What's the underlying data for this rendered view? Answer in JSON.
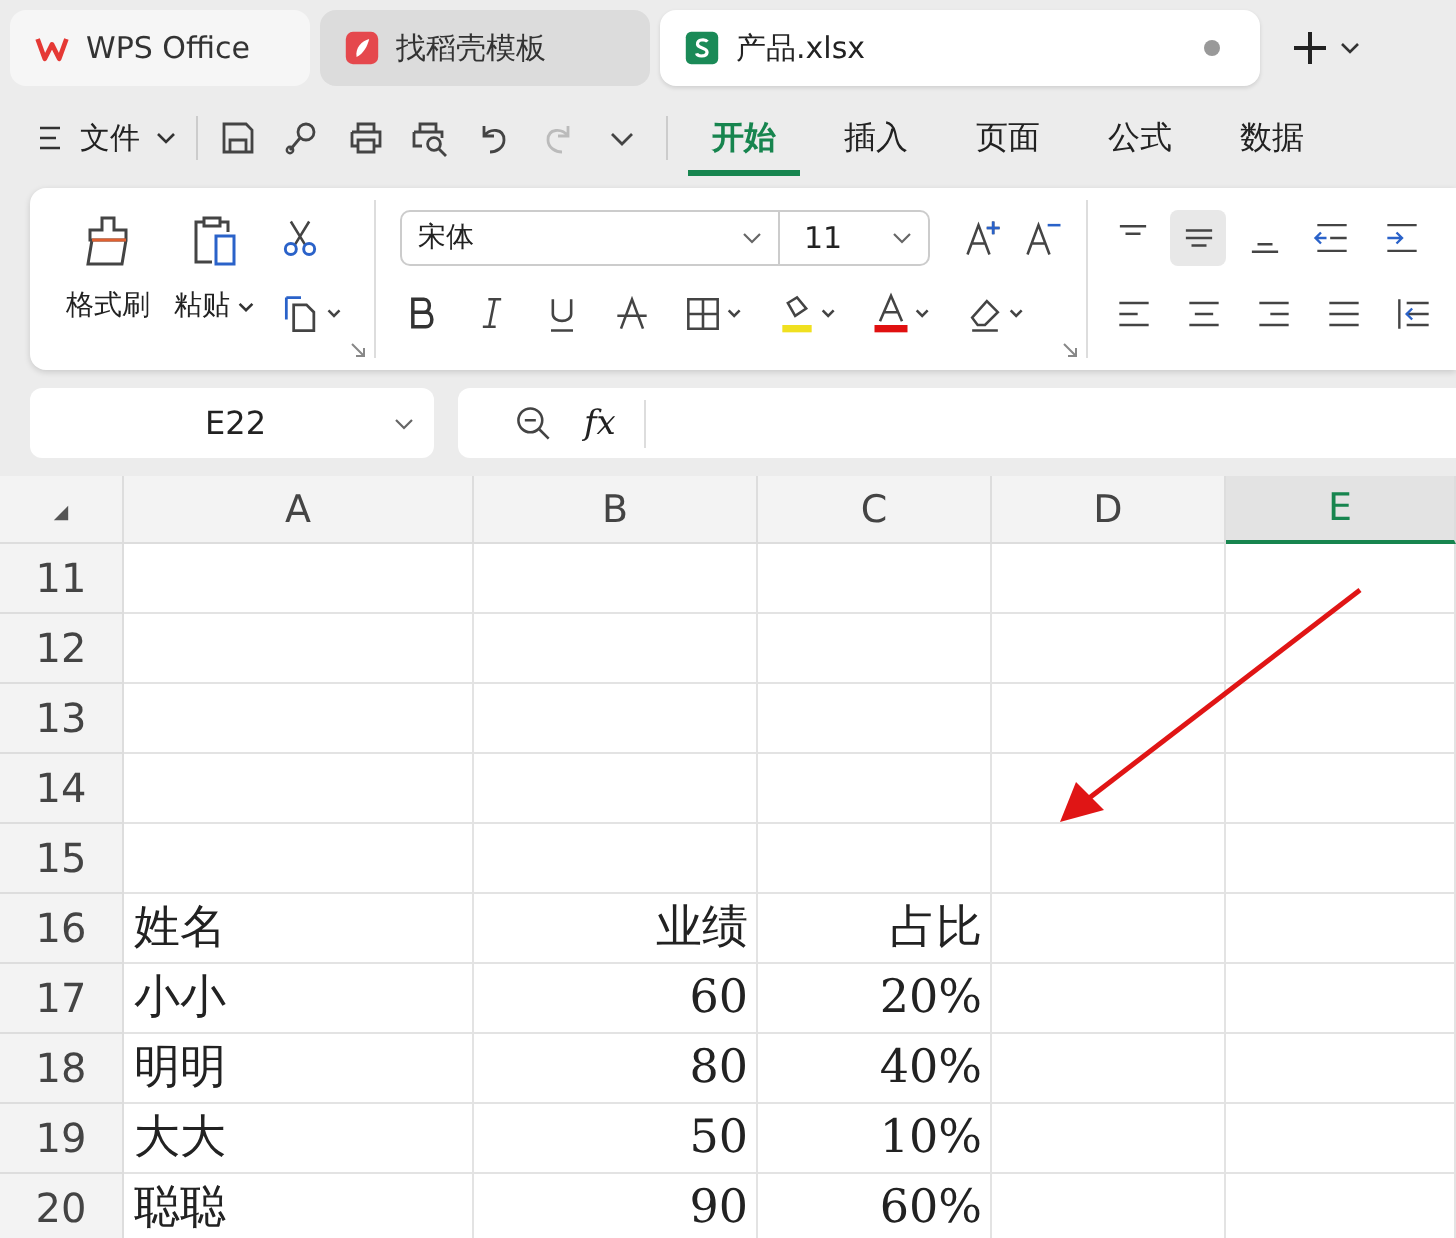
{
  "tabs": [
    {
      "label": "WPS Office",
      "kind": "wps",
      "selected": false
    },
    {
      "label": "找稻壳模板",
      "kind": "template",
      "selected": false
    },
    {
      "label": "产品.xlsx",
      "kind": "sheet",
      "selected": true,
      "unsaved": true
    }
  ],
  "menu": {
    "file": "文件",
    "ribbon_tabs": [
      {
        "label": "开始",
        "selected": true
      },
      {
        "label": "插入",
        "selected": false
      },
      {
        "label": "页面",
        "selected": false
      },
      {
        "label": "公式",
        "selected": false
      },
      {
        "label": "数据",
        "selected": false
      }
    ]
  },
  "ribbon": {
    "format_painter": "格式刷",
    "paste": "粘贴",
    "font": "宋体",
    "font_size": "11",
    "vertical_align": [
      {
        "selected": false
      },
      {
        "selected": true
      },
      {
        "selected": false
      }
    ]
  },
  "formula_bar": {
    "name_box": "E22",
    "fx": "fx"
  },
  "grid": {
    "columns": [
      {
        "label": "A",
        "kind": "text",
        "selected": false
      },
      {
        "label": "B",
        "kind": "number",
        "selected": false
      },
      {
        "label": "C",
        "kind": "number",
        "selected": false
      },
      {
        "label": "D",
        "kind": "text",
        "selected": false
      },
      {
        "label": "E",
        "kind": "text",
        "selected": true
      }
    ],
    "rows": [
      {
        "number": "11",
        "cells": []
      },
      {
        "number": "12",
        "cells": []
      },
      {
        "number": "13",
        "cells": []
      },
      {
        "number": "14",
        "cells": []
      },
      {
        "number": "15",
        "cells": []
      },
      {
        "number": "16",
        "cells": [
          "姓名",
          "业绩",
          "占比"
        ]
      },
      {
        "number": "17",
        "cells": [
          "小小",
          "60",
          "20%"
        ]
      },
      {
        "number": "18",
        "cells": [
          "明明",
          "80",
          "40%"
        ]
      },
      {
        "number": "19",
        "cells": [
          "大大",
          "50",
          "10%"
        ]
      },
      {
        "number": "20",
        "cells": [
          "聪聪",
          "90",
          "60%"
        ]
      }
    ]
  }
}
